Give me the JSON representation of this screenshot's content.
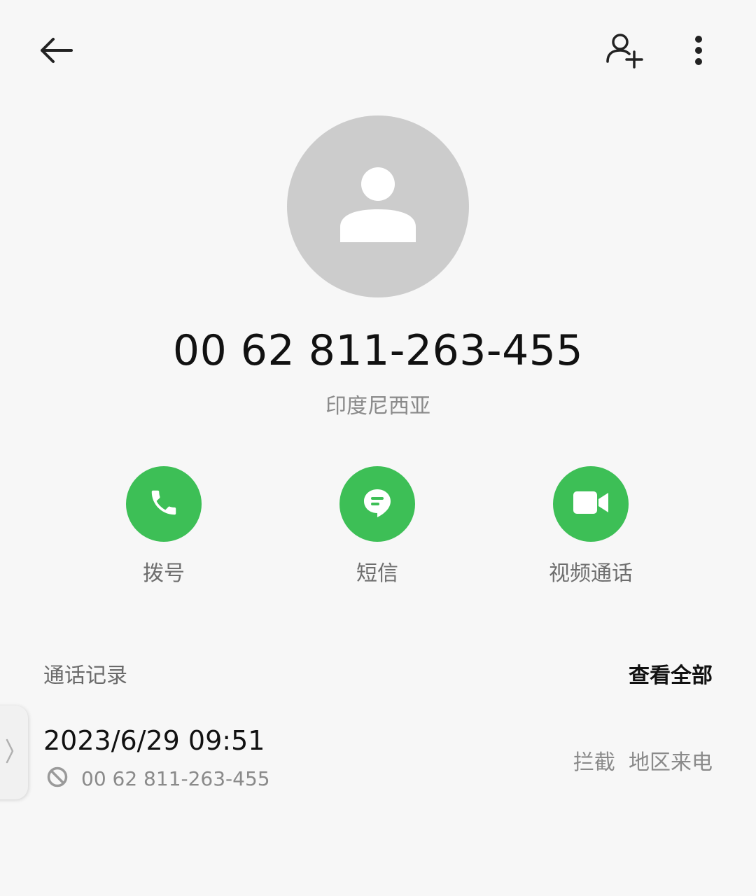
{
  "header": {
    "back_icon": "arrow-left-icon",
    "add_contact_icon": "person-add-icon",
    "more_icon": "more-vertical-icon"
  },
  "contact": {
    "number": "00 62 811-263-455",
    "location": "印度尼西亚",
    "avatar_icon": "person-placeholder-icon"
  },
  "actions": [
    {
      "label": "拨号",
      "icon": "phone-icon"
    },
    {
      "label": "短信",
      "icon": "message-icon"
    },
    {
      "label": "视频通话",
      "icon": "video-camera-icon"
    }
  ],
  "call_log": {
    "title": "通话记录",
    "view_all": "查看全部",
    "records": [
      {
        "time": "2023/6/29 09:51",
        "number": "00 62 811-263-455",
        "status_icon": "blocked-icon",
        "tags": "拦截  地区来电"
      }
    ]
  },
  "colors": {
    "background": "#f7f7f7",
    "accent": "#3dbf56",
    "avatar_bg": "#cccccc"
  }
}
